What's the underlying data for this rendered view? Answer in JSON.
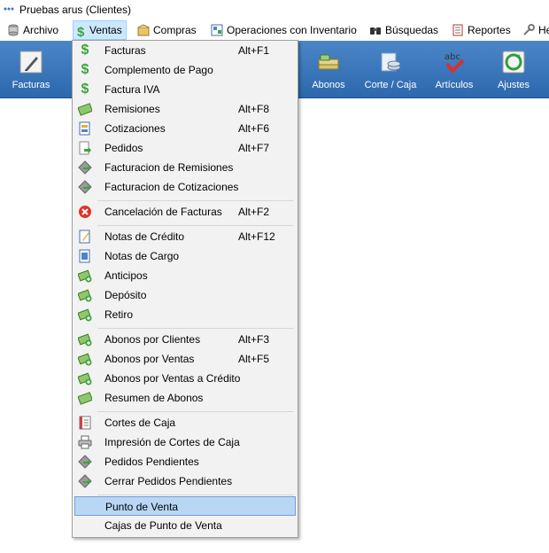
{
  "window": {
    "title": "Pruebas arus (Clientes)"
  },
  "menubar": {
    "items": [
      {
        "label": "Archivo",
        "icon": "cylinder-icon"
      },
      {
        "label": "Ventas",
        "icon": "dollar-icon"
      },
      {
        "label": "Compras",
        "icon": "package-icon"
      },
      {
        "label": "Operaciones con Inventario",
        "icon": "inventory-icon"
      },
      {
        "label": "Búsquedas",
        "icon": "binoculars-icon"
      },
      {
        "label": "Reportes",
        "icon": "report-icon"
      },
      {
        "label": "He",
        "icon": "tools-icon"
      }
    ]
  },
  "toolbar": {
    "buttons": [
      {
        "label": "Facturas",
        "icon": "pen-icon"
      },
      {
        "label": "Abonos",
        "icon": "money-stack-icon"
      },
      {
        "label": "Corte / Caja",
        "icon": "coins-icon"
      },
      {
        "label": "Artículos",
        "icon": "abc-check-icon"
      },
      {
        "label": "Ajustes",
        "icon": "recycle-icon"
      }
    ]
  },
  "ventas_menu": {
    "items": [
      {
        "label": "Facturas",
        "shortcut": "Alt+F1",
        "icon": "dollar-icon"
      },
      {
        "label": "Complemento de Pago",
        "shortcut": "",
        "icon": "dollar-icon"
      },
      {
        "label": "Factura IVA",
        "shortcut": "",
        "icon": "dollar-icon"
      },
      {
        "label": "Remisiones",
        "shortcut": "Alt+F8",
        "icon": "banknote-icon"
      },
      {
        "label": "Cotizaciones",
        "shortcut": "Alt+F6",
        "icon": "quote-icon"
      },
      {
        "label": "Pedidos",
        "shortcut": "Alt+F7",
        "icon": "order-icon"
      },
      {
        "label": "Facturacion de Remisiones",
        "shortcut": "",
        "icon": "invoice-arrow-icon"
      },
      {
        "label": "Facturacion de Cotizaciones",
        "shortcut": "",
        "icon": "invoice-arrow-icon"
      },
      {
        "label": "Cancelación de Facturas",
        "shortcut": "Alt+F2",
        "icon": "cancel-icon"
      },
      {
        "label": "Notas de Crédito",
        "shortcut": "Alt+F12",
        "icon": "credit-note-icon"
      },
      {
        "label": "Notas de Cargo",
        "shortcut": "",
        "icon": "charge-note-icon"
      },
      {
        "label": "Anticipos",
        "shortcut": "",
        "icon": "money-plus-icon"
      },
      {
        "label": "Depósito",
        "shortcut": "",
        "icon": "money-plus-icon"
      },
      {
        "label": "Retiro",
        "shortcut": "",
        "icon": "money-plus-icon"
      },
      {
        "label": "Abonos por Clientes",
        "shortcut": "Alt+F3",
        "icon": "money-plus-icon"
      },
      {
        "label": "Abonos por Ventas",
        "shortcut": "Alt+F5",
        "icon": "money-plus-icon"
      },
      {
        "label": "Abonos por Ventas a Crédito",
        "shortcut": "",
        "icon": "money-plus-icon"
      },
      {
        "label": "Resumen de Abonos",
        "shortcut": "",
        "icon": "banknote-icon"
      },
      {
        "label": "Cortes de Caja",
        "shortcut": "",
        "icon": "ledger-icon"
      },
      {
        "label": "Impresión de Cortes de Caja",
        "shortcut": "",
        "icon": "printer-icon"
      },
      {
        "label": "Pedidos Pendientes",
        "shortcut": "",
        "icon": "invoice-arrow-icon"
      },
      {
        "label": "Cerrar Pedidos Pendientes",
        "shortcut": "",
        "icon": "invoice-arrow-icon"
      },
      {
        "label": "Punto de Venta",
        "shortcut": "",
        "icon": ""
      },
      {
        "label": "Cajas de Punto de Venta",
        "shortcut": "",
        "icon": ""
      }
    ],
    "highlighted": "Punto de Venta"
  },
  "colors": {
    "toolbar": "#3a77bd",
    "menu_highlight": "#b9d7f5",
    "dollar_green": "#3da33d"
  }
}
